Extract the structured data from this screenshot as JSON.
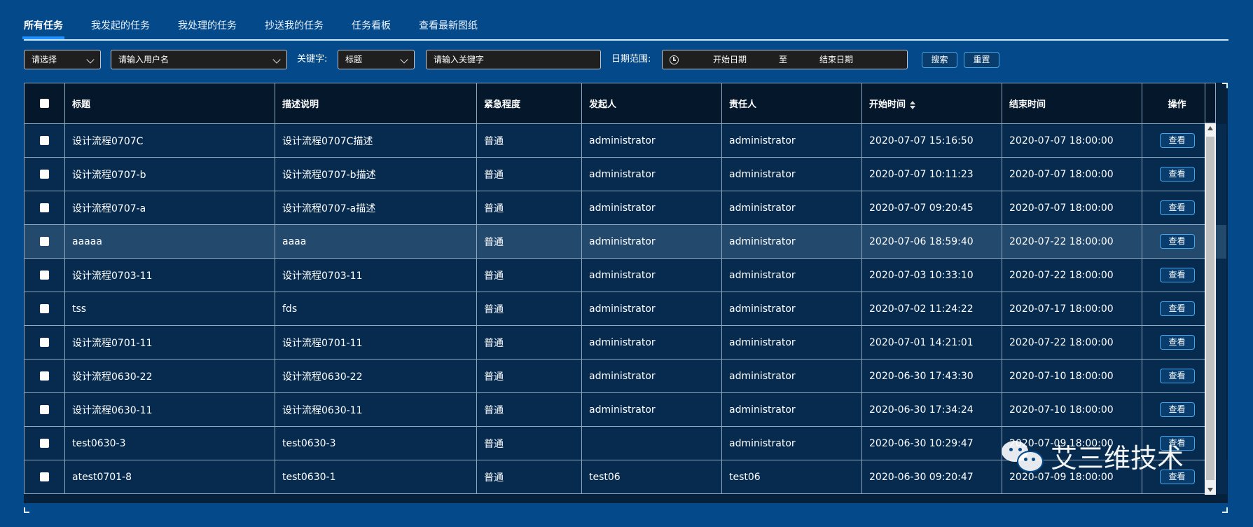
{
  "tabs": [
    {
      "label": "所有任务",
      "active": true
    },
    {
      "label": "我发起的任务",
      "active": false
    },
    {
      "label": "我处理的任务",
      "active": false
    },
    {
      "label": "抄送我的任务",
      "active": false
    },
    {
      "label": "任务看板",
      "active": false
    },
    {
      "label": "查看最新图纸",
      "active": false
    }
  ],
  "filters": {
    "type_select": "请选择",
    "user_select_placeholder": "请输入用户名",
    "keyword_label": "关键字:",
    "keyword_field_select": "标题",
    "keyword_placeholder": "请输入关键字",
    "date_label": "日期范围:",
    "date_start_placeholder": "开始日期",
    "date_separator": "至",
    "date_end_placeholder": "结束日期",
    "search_button": "搜索",
    "reset_button": "重置"
  },
  "table": {
    "columns": [
      "标题",
      "描述说明",
      "紧急程度",
      "发起人",
      "责任人",
      "开始时间",
      "结束时间",
      "操作"
    ],
    "sortable_column": "开始时间",
    "view_label": "查看",
    "hover_row_index": 3,
    "rows": [
      {
        "title": "设计流程0707C",
        "desc": "设计流程0707C描述",
        "urgency": "普通",
        "initiator": "administrator",
        "assignee": "administrator",
        "start": "2020-07-07 15:16:50",
        "end": "2020-07-07 18:00:00"
      },
      {
        "title": "设计流程0707-b",
        "desc": "设计流程0707-b描述",
        "urgency": "普通",
        "initiator": "administrator",
        "assignee": "administrator",
        "start": "2020-07-07 10:11:23",
        "end": "2020-07-07 18:00:00"
      },
      {
        "title": "设计流程0707-a",
        "desc": "设计流程0707-a描述",
        "urgency": "普通",
        "initiator": "administrator",
        "assignee": "administrator",
        "start": "2020-07-07 09:20:45",
        "end": "2020-07-07 18:00:00"
      },
      {
        "title": "aaaaa",
        "desc": "aaaa",
        "urgency": "普通",
        "initiator": "administrator",
        "assignee": "administrator",
        "start": "2020-07-06 18:59:40",
        "end": "2020-07-22 18:00:00"
      },
      {
        "title": "设计流程0703-11",
        "desc": "设计流程0703-11",
        "urgency": "普通",
        "initiator": "administrator",
        "assignee": "administrator",
        "start": "2020-07-03 10:33:10",
        "end": "2020-07-22 18:00:00"
      },
      {
        "title": "tss",
        "desc": "fds",
        "urgency": "普通",
        "initiator": "administrator",
        "assignee": "administrator",
        "start": "2020-07-02 11:24:22",
        "end": "2020-07-17 18:00:00"
      },
      {
        "title": "设计流程0701-11",
        "desc": "设计流程0701-11",
        "urgency": "普通",
        "initiator": "administrator",
        "assignee": "administrator",
        "start": "2020-07-01 14:21:01",
        "end": "2020-07-22 18:00:00"
      },
      {
        "title": "设计流程0630-22",
        "desc": "设计流程0630-22",
        "urgency": "普通",
        "initiator": "administrator",
        "assignee": "administrator",
        "start": "2020-06-30 17:43:30",
        "end": "2020-07-10 18:00:00"
      },
      {
        "title": "设计流程0630-11",
        "desc": "设计流程0630-11",
        "urgency": "普通",
        "initiator": "administrator",
        "assignee": "administrator",
        "start": "2020-06-30 17:34:24",
        "end": "2020-07-10 18:00:00"
      },
      {
        "title": "test0630-3",
        "desc": "test0630-3",
        "urgency": "普通",
        "initiator": "",
        "assignee": "administrator",
        "start": "2020-06-30 10:29:47",
        "end": "2020-07-09 18:00:00"
      },
      {
        "title": "atest0701-8",
        "desc": "test0630-1",
        "urgency": "普通",
        "initiator": "test06",
        "assignee": "test06",
        "start": "2020-06-30 09:20:47",
        "end": "2020-07-09 18:00:00"
      }
    ]
  },
  "watermark": {
    "text": "艾三维技术",
    "icon": "wechat-icon"
  },
  "colors": {
    "background": "#04498a",
    "table_bg": "#062b4f",
    "header_bg": "#04172b",
    "accent": "#1e90ff"
  }
}
